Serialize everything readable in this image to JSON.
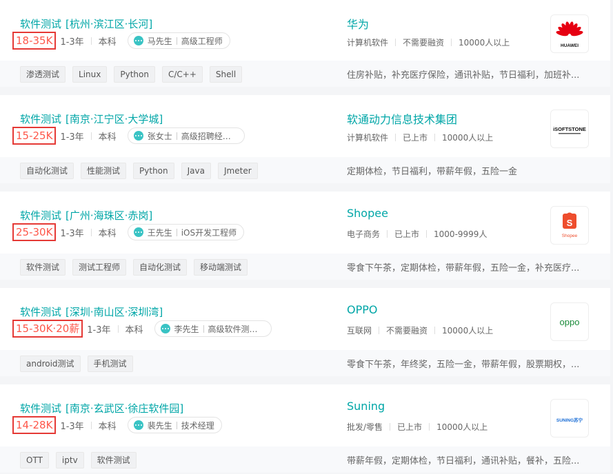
{
  "jobs": [
    {
      "title": "软件测试",
      "location": "[杭州·滨江区·长河]",
      "salary": "18-35K",
      "experience": "1-3年",
      "education": "本科",
      "recruiter_name": "马先生",
      "recruiter_title": "高级工程师",
      "skills": [
        "渗透测试",
        "Linux",
        "Python",
        "C/C++",
        "Shell"
      ],
      "company": "华为",
      "industry": "计算机软件",
      "stage": "不需要融资",
      "size": "10000人以上",
      "benefits": "住房补贴，补充医疗保险，通讯补贴，节日福利，加班补...",
      "logo_text": "HUAWEI"
    },
    {
      "title": "软件测试",
      "location": "[南京·江宁区·大学城]",
      "salary": "15-25K",
      "experience": "1-3年",
      "education": "本科",
      "recruiter_name": "张女士",
      "recruiter_title": "高级招聘经理...",
      "skills": [
        "自动化测试",
        "性能测试",
        "Python",
        "Java",
        "Jmeter"
      ],
      "company": "软通动力信息技术集团",
      "industry": "计算机软件",
      "stage": "已上市",
      "size": "10000人以上",
      "benefits": "定期体检，节日福利，带薪年假，五险一金",
      "logo_text": "iSOFTSTONE"
    },
    {
      "title": "软件测试",
      "location": "[广州·海珠区·赤岗]",
      "salary": "25-30K",
      "experience": "1-3年",
      "education": "本科",
      "recruiter_name": "王先生",
      "recruiter_title": "iOS开发工程师",
      "skills": [
        "软件测试",
        "测试工程师",
        "自动化测试",
        "移动端测试"
      ],
      "company": "Shopee",
      "industry": "电子商务",
      "stage": "已上市",
      "size": "1000-9999人",
      "benefits": "零食下午茶，定期体检，带薪年假，五险一金，补充医疗...",
      "logo_text": "Shopee"
    },
    {
      "title": "软件测试",
      "location": "[深圳·南山区·深圳湾]",
      "salary": "15-30K·20薪",
      "experience": "1-3年",
      "education": "本科",
      "recruiter_name": "李先生",
      "recruiter_title": "高级软件测试...",
      "skills": [
        "android测试",
        "手机测试"
      ],
      "company": "OPPO",
      "industry": "互联网",
      "stage": "不需要融资",
      "size": "10000人以上",
      "benefits": "零食下午茶，年终奖，五险一金，带薪年假，股票期权，...",
      "logo_text": "oppo"
    },
    {
      "title": "软件测试",
      "location": "[南京·玄武区·徐庄软件园]",
      "salary": "14-28K",
      "experience": "1-3年",
      "education": "本科",
      "recruiter_name": "裴先生",
      "recruiter_title": "技术经理",
      "skills": [
        "OTT",
        "iptv",
        "软件测试"
      ],
      "company": "Suning",
      "industry": "批发/零售",
      "stage": "已上市",
      "size": "10000人以上",
      "benefits": "带薪年假，定期体检，节日福利，通讯补贴，餐补，五险...",
      "logo_text": "SUNING苏宁"
    }
  ],
  "colors": {
    "accent": "#00a6a7",
    "salary": "#fe574a",
    "highlight_box": "#e53935",
    "huawei_red": "#e60012",
    "shopee_orange": "#ee4d2d",
    "oppo_green": "#1b8b3a",
    "suning_blue": "#1a6dd6"
  }
}
